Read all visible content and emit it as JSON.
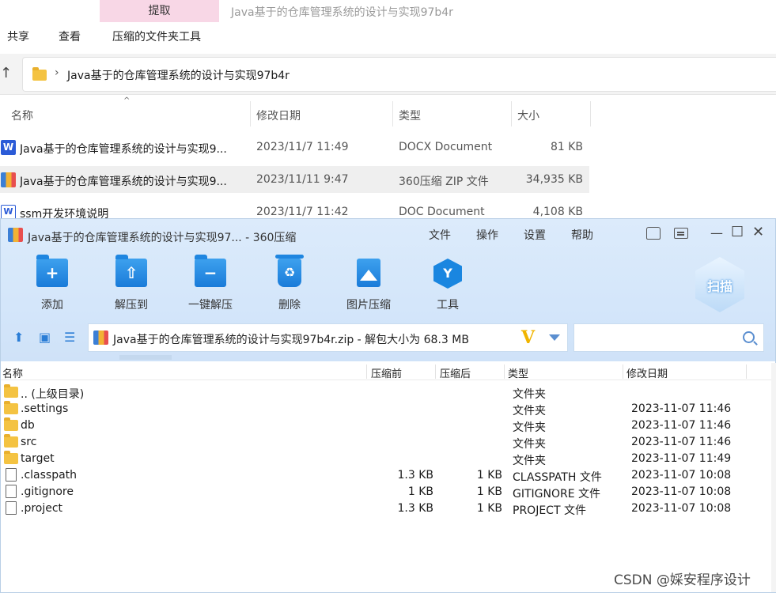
{
  "explorer": {
    "extract_tab": "提取",
    "window_title": "Java基于的仓库管理系统的设计与实现97b4r",
    "menu": [
      "共享",
      "查看",
      "压缩的文件夹工具"
    ],
    "address": "Java基于的仓库管理系统的设计与实现97b4r",
    "columns": [
      "名称",
      "修改日期",
      "类型",
      "大小"
    ],
    "rows": [
      {
        "icon": "word-icon",
        "name": "Java基于的仓库管理系统的设计与实现9...",
        "date": "2023/11/7 11:49",
        "type": "DOCX Document",
        "size": "81 KB"
      },
      {
        "icon": "zip-icon",
        "name": "Java基于的仓库管理系统的设计与实现9...",
        "date": "2023/11/11 9:47",
        "type": "360压缩 ZIP 文件",
        "size": "34,935 KB"
      },
      {
        "icon": "doc-icon",
        "name": "ssm开发环境说明",
        "date": "2023/11/7 11:42",
        "type": "DOC Document",
        "size": "4,108 KB"
      }
    ]
  },
  "zip": {
    "title": "Java基于的仓库管理系统的设计与实现97... - 360压缩",
    "menu": [
      "文件",
      "操作",
      "设置",
      "帮助"
    ],
    "tools": [
      "添加",
      "解压到",
      "一键解压",
      "删除",
      "图片压缩",
      "工具"
    ],
    "scan_label": "扫描",
    "path": "Java基于的仓库管理系统的设计与实现97b4r.zip - 解包大小为 68.3 MB",
    "search_placeholder": "",
    "columns": [
      "名称",
      "压缩前",
      "压缩后",
      "类型",
      "修改日期"
    ],
    "rows": [
      {
        "kind": "folder",
        "name": ".. (上级目录)",
        "size": "",
        "packed": "",
        "type": "文件夹",
        "date": ""
      },
      {
        "kind": "folder",
        "name": ".settings",
        "size": "",
        "packed": "",
        "type": "文件夹",
        "date": "2023-11-07 11:46"
      },
      {
        "kind": "folder",
        "name": "db",
        "size": "",
        "packed": "",
        "type": "文件夹",
        "date": "2023-11-07 11:46"
      },
      {
        "kind": "folder",
        "name": "src",
        "size": "",
        "packed": "",
        "type": "文件夹",
        "date": "2023-11-07 11:46"
      },
      {
        "kind": "folder",
        "name": "target",
        "size": "",
        "packed": "",
        "type": "文件夹",
        "date": "2023-11-07 11:49"
      },
      {
        "kind": "file",
        "name": ".classpath",
        "size": "1.3 KB",
        "packed": "1 KB",
        "type": "CLASSPATH 文件",
        "date": "2023-11-07 10:08"
      },
      {
        "kind": "file",
        "name": ".gitignore",
        "size": "1 KB",
        "packed": "1 KB",
        "type": "GITIGNORE 文件",
        "date": "2023-11-07 10:08"
      },
      {
        "kind": "file",
        "name": ".project",
        "size": "1.3 KB",
        "packed": "1 KB",
        "type": "PROJECT 文件",
        "date": "2023-11-07 10:08"
      }
    ]
  },
  "watermark": "CSDN @<span>婇</span>安程序设计"
}
